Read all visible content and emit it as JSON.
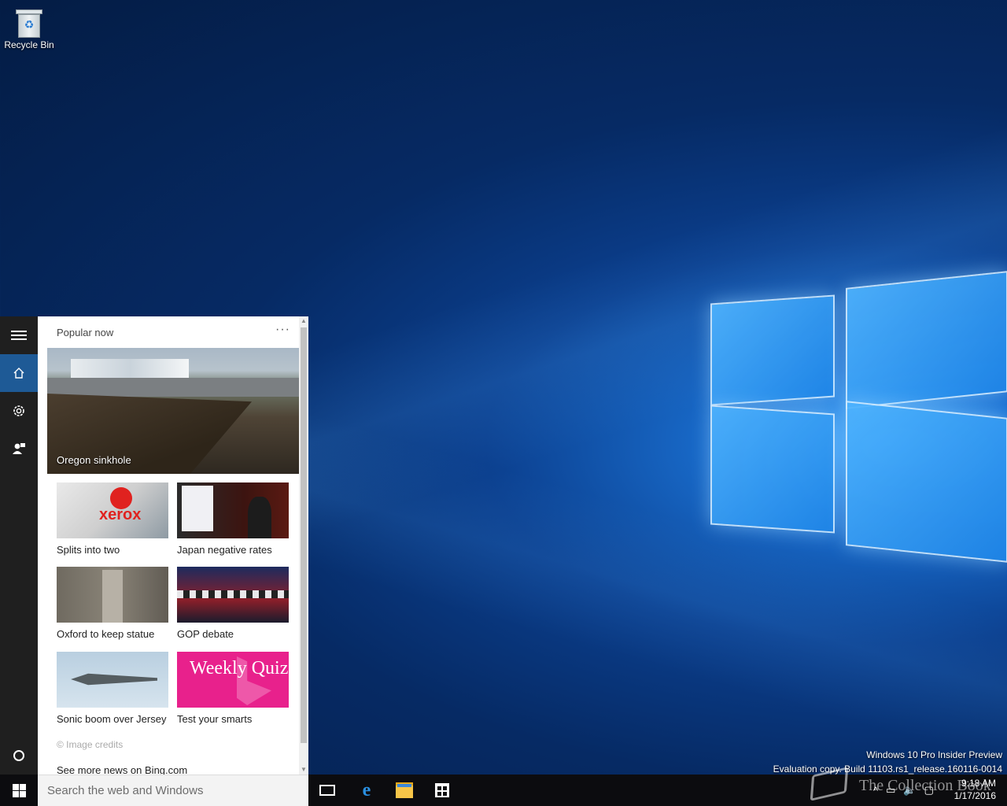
{
  "desktop": {
    "icons": [
      {
        "label": "Recycle Bin",
        "icon": "recycle-bin-icon"
      }
    ],
    "watermark": {
      "line1": "Windows 10 Pro Insider Preview",
      "line2": "Evaluation copy. Build 11103.rs1_release.160116-0014"
    }
  },
  "cortana": {
    "sidebar": [
      {
        "name": "menu",
        "icon": "hamburger-icon"
      },
      {
        "name": "home",
        "icon": "home-icon",
        "active": true
      },
      {
        "name": "notebook",
        "icon": "gear-icon"
      },
      {
        "name": "feedback",
        "icon": "feedback-icon"
      },
      {
        "name": "cortana",
        "icon": "cortana-circle-icon"
      }
    ],
    "section_title": "Popular now",
    "more_label": "···",
    "hero": {
      "caption": "Oregon sinkhole"
    },
    "cards": [
      {
        "caption": "Splits into two",
        "thumb_text": "xerox"
      },
      {
        "caption": "Japan negative rates"
      },
      {
        "caption": "Oxford to keep statue"
      },
      {
        "caption": "GOP debate"
      },
      {
        "caption": "Sonic boom over Jersey"
      },
      {
        "caption": "Test your smarts",
        "thumb_text": "Weekly Quiz"
      }
    ],
    "image_credits": "© Image credits",
    "more_news": "See more news on Bing.com"
  },
  "taskbar": {
    "search_placeholder": "Search the web and Windows",
    "apps": [
      "task-view-icon",
      "edge-icon",
      "file-explorer-icon",
      "store-icon"
    ],
    "tray": {
      "chevron": "^",
      "network": "network-icon",
      "volume": "volume-icon",
      "notifications": "action-center-icon"
    },
    "clock": {
      "time": "9:18 AM",
      "date": "1/17/2016"
    }
  },
  "overlay": {
    "brand": "The Collection Book"
  },
  "colors": {
    "accent": "#1e5a96",
    "taskbar": "#0c0c0f",
    "quiz": "#e8218c"
  }
}
